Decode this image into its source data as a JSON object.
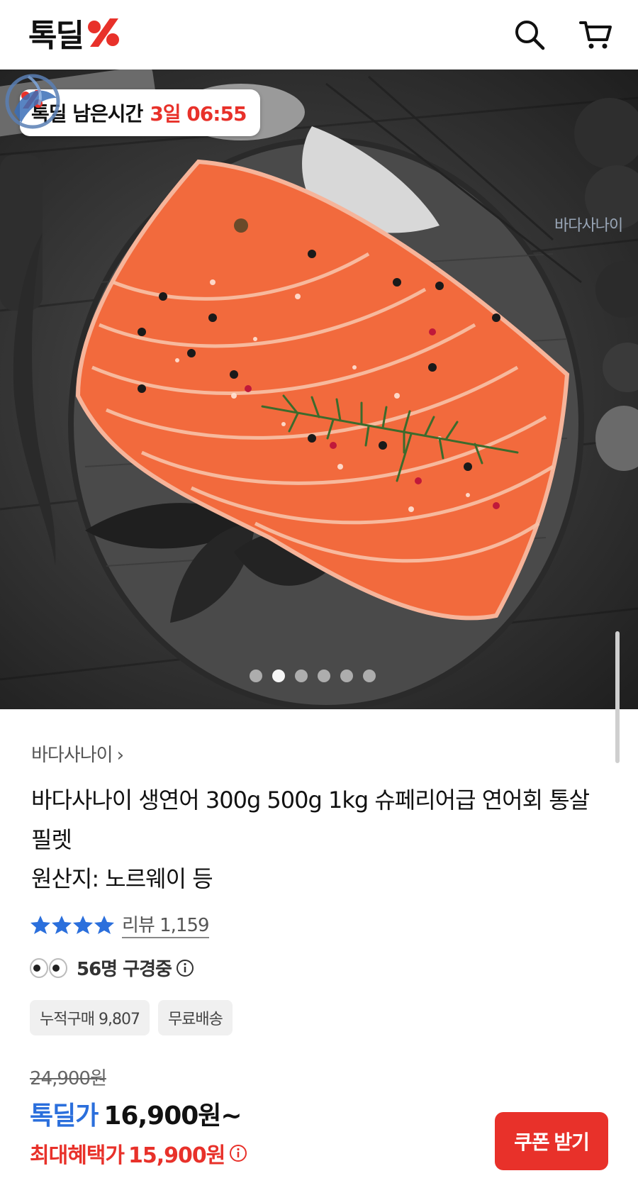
{
  "header": {
    "logo_text": "톡딜",
    "search_icon": "search-icon",
    "cart_icon": "cart-icon"
  },
  "hero": {
    "timer_label": "톡딜 남은시간",
    "timer_value": "3일 06:55",
    "watermark_text": "바다사나이",
    "carousel": {
      "total": 6,
      "active_index": 1
    }
  },
  "product": {
    "seller": "바다사나이",
    "title": "바다사나이 생연어 300g 500g 1kg 슈페리어급 연어회 통살 필렛",
    "origin": "원산지: 노르웨이 등",
    "rating": {
      "stars": 4,
      "review_label": "리뷰 1,159"
    },
    "viewers": "56명 구경중",
    "chips": [
      "누적구매 9,807",
      "무료배송"
    ]
  },
  "price": {
    "original": "24,900원",
    "deal_label": "톡딜가",
    "deal_price": "16,900원~",
    "max_label": "최대혜택가",
    "max_price": "15,900원",
    "coupon_button": "쿠폰 받기"
  },
  "colors": {
    "brand_red": "#e8312a",
    "deal_blue": "#2b6fdc",
    "star_blue": "#2b6fdc",
    "salmon": "#f26a3d"
  }
}
